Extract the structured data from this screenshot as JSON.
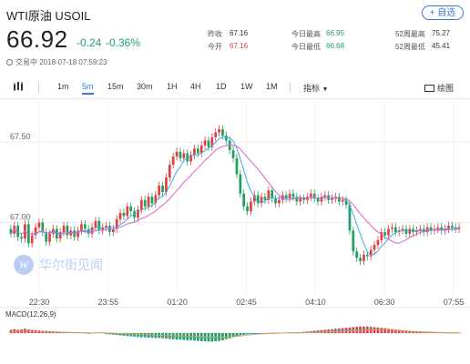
{
  "header": {
    "title": "WTI原油  USOIL",
    "add_button": "+ 自选",
    "price": "66.92",
    "change": "-0.24",
    "change_pct": "-0.36%",
    "status": "交易中 2018-07-18 07:59:23"
  },
  "stats": [
    {
      "label": "昨收",
      "value": "67.16",
      "color": "#333333"
    },
    {
      "label": "今开",
      "value": "67.16",
      "color": "#e04040"
    },
    {
      "label": "今日最高",
      "value": "66.95",
      "color": "#20a060"
    },
    {
      "label": "今日最低",
      "value": "66.68",
      "color": "#20a060"
    },
    {
      "label": "52周最高",
      "value": "75.27",
      "color": "#333333"
    },
    {
      "label": "52周最低",
      "value": "45.41",
      "color": "#333333"
    }
  ],
  "toolbar": {
    "intervals": [
      "1m",
      "5m",
      "15m",
      "30m",
      "1H",
      "4H",
      "1D",
      "1W",
      "1M"
    ],
    "active_interval": "5m",
    "indicator_label": "指标",
    "draw_label": "绘图"
  },
  "watermark": "华尔街见闻",
  "chart_data": {
    "type": "candlestick",
    "y_ticks": [
      67.5,
      67.0
    ],
    "y_tick_labels": [
      "67.50",
      "67.00"
    ],
    "ylim": [
      66.55,
      67.75
    ],
    "x_tick_labels": [
      "22:30",
      "23:55",
      "01:20",
      "02:45",
      "04:10",
      "06:30",
      "07:55"
    ],
    "indicator_label": "MACD(12,26,9)",
    "colors": {
      "up": "#e04040",
      "down": "#20a060",
      "ma_fast": "#3aaee0",
      "ma_slow": "#e060d0",
      "dif": "#3aaee0",
      "dea": "#f0a040"
    },
    "closes": [
      66.93,
      66.98,
      66.91,
      66.9,
      66.99,
      66.87,
      66.92,
      66.97,
      67.0,
      66.94,
      66.88,
      66.93,
      66.96,
      66.9,
      66.94,
      66.98,
      66.92,
      66.95,
      66.91,
      66.95,
      66.99,
      66.96,
      66.93,
      66.97,
      67.01,
      66.95,
      66.97,
      66.98,
      66.94,
      66.96,
      67.02,
      67.06,
      67.04,
      67.1,
      67.07,
      67.03,
      67.08,
      67.14,
      67.1,
      67.16,
      67.12,
      67.17,
      67.23,
      67.19,
      67.28,
      67.36,
      67.41,
      67.44,
      67.4,
      67.43,
      67.38,
      67.42,
      67.46,
      67.43,
      67.48,
      67.51,
      67.47,
      67.53,
      67.56,
      67.58,
      67.54,
      67.51,
      67.45,
      67.4,
      67.3,
      67.18,
      67.1,
      67.07,
      67.13,
      67.17,
      67.12,
      67.16,
      67.14,
      67.2,
      67.15,
      67.12,
      67.14,
      67.17,
      67.15,
      67.18,
      67.16,
      67.13,
      67.15,
      67.14,
      67.16,
      67.18,
      67.15,
      67.13,
      67.16,
      67.17,
      67.14,
      67.15,
      67.16,
      67.13,
      67.14,
      67.11,
      66.95,
      66.82,
      66.78,
      66.76,
      66.8,
      66.79,
      66.83,
      66.86,
      66.89,
      66.94,
      66.92,
      66.96,
      66.97,
      66.94,
      66.95,
      66.96,
      66.93,
      66.96,
      66.94,
      66.95,
      66.96,
      66.94,
      66.97,
      66.95,
      66.96,
      66.97,
      66.95,
      66.96,
      66.98,
      66.97,
      66.96,
      66.97
    ],
    "macd_hist": [
      0.01,
      0.012,
      0.01,
      0.011,
      0.013,
      0.011,
      0.01,
      0.009,
      0.008,
      0.007,
      0.007,
      0.006,
      0.005,
      0.004,
      0.003,
      0.003,
      0.003,
      0.002,
      0.002,
      0.001,
      0.002,
      0.001,
      0.0,
      0.001,
      0.002,
      0.002,
      0.002,
      -0.003,
      -0.004,
      -0.005,
      -0.006,
      -0.007,
      -0.008,
      -0.009,
      -0.01,
      -0.011,
      -0.012,
      -0.013,
      -0.013,
      -0.014,
      -0.014,
      -0.015,
      -0.015,
      -0.016,
      -0.017,
      -0.018,
      -0.019,
      -0.02,
      -0.02,
      -0.021,
      -0.022,
      -0.022,
      -0.023,
      -0.024,
      -0.025,
      -0.025,
      -0.026,
      -0.026,
      -0.025,
      -0.024,
      -0.022,
      -0.019,
      -0.016,
      -0.013,
      -0.01,
      -0.007,
      -0.005,
      -0.004,
      -0.003,
      -0.003,
      -0.002,
      -0.002,
      -0.001,
      -0.001,
      0.0,
      0.0,
      0.0,
      0.001,
      0.001,
      0.002,
      0.002,
      0.003,
      0.003,
      0.004,
      0.005,
      0.006,
      0.007,
      0.008,
      0.009,
      0.01,
      0.011,
      0.012,
      0.013,
      0.014,
      0.015,
      0.016,
      0.017,
      0.018,
      0.019,
      0.02,
      0.02,
      0.02,
      0.019,
      0.018,
      0.017,
      0.016,
      0.015,
      0.013,
      0.012,
      0.011,
      0.01,
      0.009,
      0.008,
      0.007,
      0.006,
      0.006,
      0.005,
      0.004,
      0.004,
      0.003,
      0.003,
      0.002,
      0.002,
      0.002,
      0.001,
      0.001,
      0.001,
      0.001
    ]
  }
}
